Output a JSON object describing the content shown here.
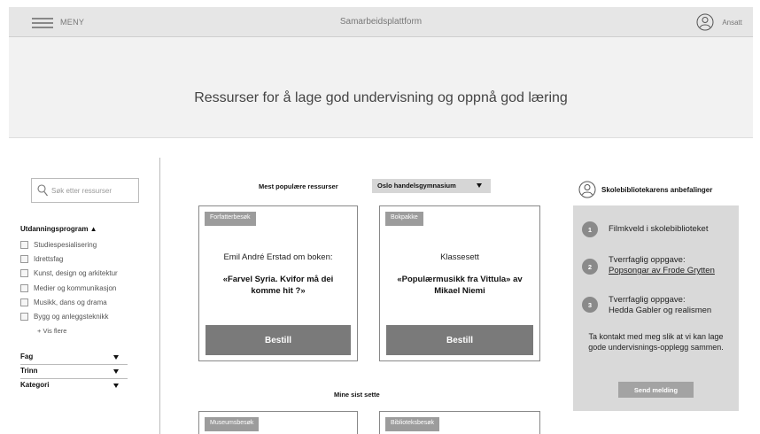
{
  "header": {
    "menu_label": "MENY",
    "app_title": "Samarbeidsplattform",
    "user_label": "Ansatt"
  },
  "hero": {
    "title": "Ressurser for å lage god undervisning og oppnå god læring"
  },
  "sidebar": {
    "search_placeholder": "Søk etter ressurser",
    "program_heading": "Utdanningsprogram ▲",
    "programs": [
      "Studiespesialisering",
      "Idrettsfag",
      "Kunst, design og arkitektur",
      "Medier og kommunikasjon",
      "Musikk, dans og drama",
      "Bygg og anleggsteknikk"
    ],
    "show_more": "+ Vis flere",
    "filters": [
      "Fag",
      "Trinn",
      "Kategori"
    ]
  },
  "popular": {
    "label": "Mest populære ressurser",
    "school": "Oslo handelsgymnasium",
    "cards": [
      {
        "tag": "Forfatterbesøk",
        "line": "Emil André Erstad om boken:",
        "title": "«Farvel Syria. Kvifor må dei komme hit ?»",
        "button": "Bestill"
      },
      {
        "tag": "Bokpakke",
        "line": "Klassesett",
        "title": "«Populærmusikk fra Vittula» av Mikael Niemi",
        "button": "Bestill"
      }
    ]
  },
  "recent": {
    "label": "Mine sist sette",
    "cards": [
      {
        "tag": "Museumsbesøk"
      },
      {
        "tag": "Biblioteksbesøk"
      }
    ]
  },
  "recommendations": {
    "title": "Skolebibliotekarens anbefalinger",
    "items": [
      {
        "num": "1",
        "text": "Filmkveld i skolebiblioteket"
      },
      {
        "num": "2",
        "prefix": "Tverrfaglig oppgave:",
        "link": "Popsongar av Frode Grytten"
      },
      {
        "num": "3",
        "prefix": "Tverrfaglig oppgave:",
        "text": "Hedda Gabler og realismen"
      }
    ],
    "contact_text": "Ta kontakt med meg slik at vi kan lage gode undervisnings-opplegg sammen.",
    "send_button": "Send melding"
  }
}
